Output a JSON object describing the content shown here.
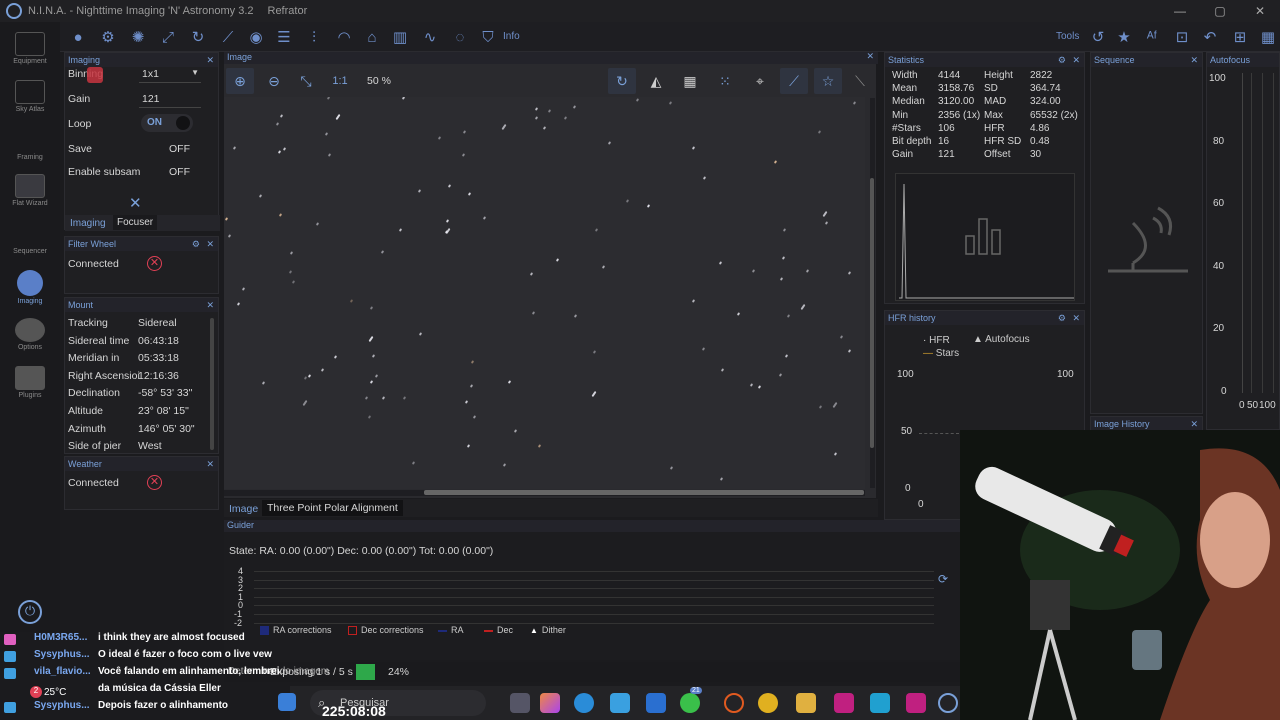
{
  "window": {
    "app_title": "N.I.N.A. - Nighttime Imaging 'N' Astronomy 3.2",
    "profile": "Refrator"
  },
  "toolbar": {
    "info_label": "Info",
    "tools_label": "Tools"
  },
  "nav": {
    "items": [
      "Equipment",
      "Sky Atlas",
      "Framing",
      "Flat Wizard",
      "Sequencer",
      "Imaging",
      "Options",
      "Plugins"
    ]
  },
  "imaging": {
    "title": "Imaging",
    "binning_label": "Binning",
    "binning_value": "1x1",
    "gain_label": "Gain",
    "gain_value": "121",
    "loop_label": "Loop",
    "loop_value": "ON",
    "save_label": "Save",
    "save_value": "OFF",
    "subsample_label": "Enable subsam",
    "subsample_value": "OFF",
    "tabs": [
      "Imaging",
      "Focuser"
    ]
  },
  "filter_wheel": {
    "title": "Filter Wheel",
    "connected_label": "Connected"
  },
  "mount": {
    "title": "Mount",
    "rows": [
      {
        "label": "Tracking",
        "value": "Sidereal"
      },
      {
        "label": "Sidereal time",
        "value": "06:43:18"
      },
      {
        "label": "Meridian in",
        "value": "05:33:18"
      },
      {
        "label": "Right Ascensioi",
        "value": "12:16:36"
      },
      {
        "label": "Declination",
        "value": "-58° 53' 33\""
      },
      {
        "label": "Altitude",
        "value": "23° 08' 15\""
      },
      {
        "label": "Azimuth",
        "value": "146° 05' 30\""
      },
      {
        "label": "Side of pier",
        "value": "West"
      }
    ]
  },
  "weather": {
    "title": "Weather",
    "connected_label": "Connected"
  },
  "image_panel": {
    "title": "Image",
    "ratio_label": "1:1",
    "zoom": "50 %",
    "tabs": [
      "Image",
      "Three Point Polar Alignment"
    ]
  },
  "statistics": {
    "title": "Statistics",
    "rows": [
      {
        "l1": "Width",
        "v1": "4144",
        "l2": "Height",
        "v2": "2822"
      },
      {
        "l1": "Mean",
        "v1": "3158.76",
        "l2": "SD",
        "v2": "364.74"
      },
      {
        "l1": "Median",
        "v1": "3120.00",
        "l2": "MAD",
        "v2": "324.00"
      },
      {
        "l1": "Min",
        "v1": "2356 (1x)",
        "l2": "Max",
        "v2": "65532 (2x)"
      },
      {
        "l1": "#Stars",
        "v1": "106",
        "l2": "HFR",
        "v2": "4.86"
      },
      {
        "l1": "Bit depth",
        "v1": "16",
        "l2": "HFR SD",
        "v2": "0.48"
      },
      {
        "l1": "Gain",
        "v1": "121",
        "l2": "Offset",
        "v2": "30"
      }
    ]
  },
  "sequence": {
    "title": "Sequence"
  },
  "autofocus": {
    "title": "Autofocus",
    "y_ticks": [
      "100",
      "80",
      "60",
      "40",
      "20",
      "0"
    ],
    "x_ticks": [
      "0",
      "50",
      "100"
    ]
  },
  "hfr_history": {
    "title": "HFR history",
    "legend_hfr": "HFR",
    "legend_autofocus": "Autofocus",
    "legend_stars": "Stars",
    "y_ticks_left": [
      "100",
      "50",
      "0"
    ],
    "y_ticks_right": [
      "100"
    ],
    "x_ticks": [
      "0"
    ]
  },
  "image_history": {
    "title": "Image History"
  },
  "guider": {
    "title": "Guider",
    "state": "State:  RA: 0.00 (0.00\")  Dec: 0.00 (0.00\")  Tot: 0.00 (0.00\")",
    "y_ticks": [
      "4",
      "3",
      "2",
      "1",
      "0",
      "-1",
      "-2"
    ],
    "legend": [
      "RA corrections",
      "Dec corrections",
      "RA",
      "Dec",
      "Dither"
    ]
  },
  "status": {
    "exposing": "Exposing 1 s / 5 s",
    "progress": 0.24,
    "progress_label": "24%",
    "framing": "Determinando imagem"
  },
  "chat": [
    {
      "user": "H0M3R65...",
      "msg": "i think they are almost focused"
    },
    {
      "user": "Sysyphus...",
      "msg": "O ideal é fazer o foco com o live vew"
    },
    {
      "user": "vila_flavio...",
      "msg": "Você falando em alinhamento, lembrei"
    },
    {
      "user": "",
      "msg": "da música da Cássia Eller"
    },
    {
      "user": "Sysyphus...",
      "msg": "Depois fazer o alinhamento"
    }
  ],
  "taskbar": {
    "search": "Pesquisar",
    "clock": "225:08:08",
    "weather_temp": "25°C",
    "whatsapp_badge": "21",
    "weather_badge": "2"
  },
  "colors": {
    "accent": "#7aa0d8",
    "error": "#e04055",
    "progress": "#2ea84a"
  }
}
